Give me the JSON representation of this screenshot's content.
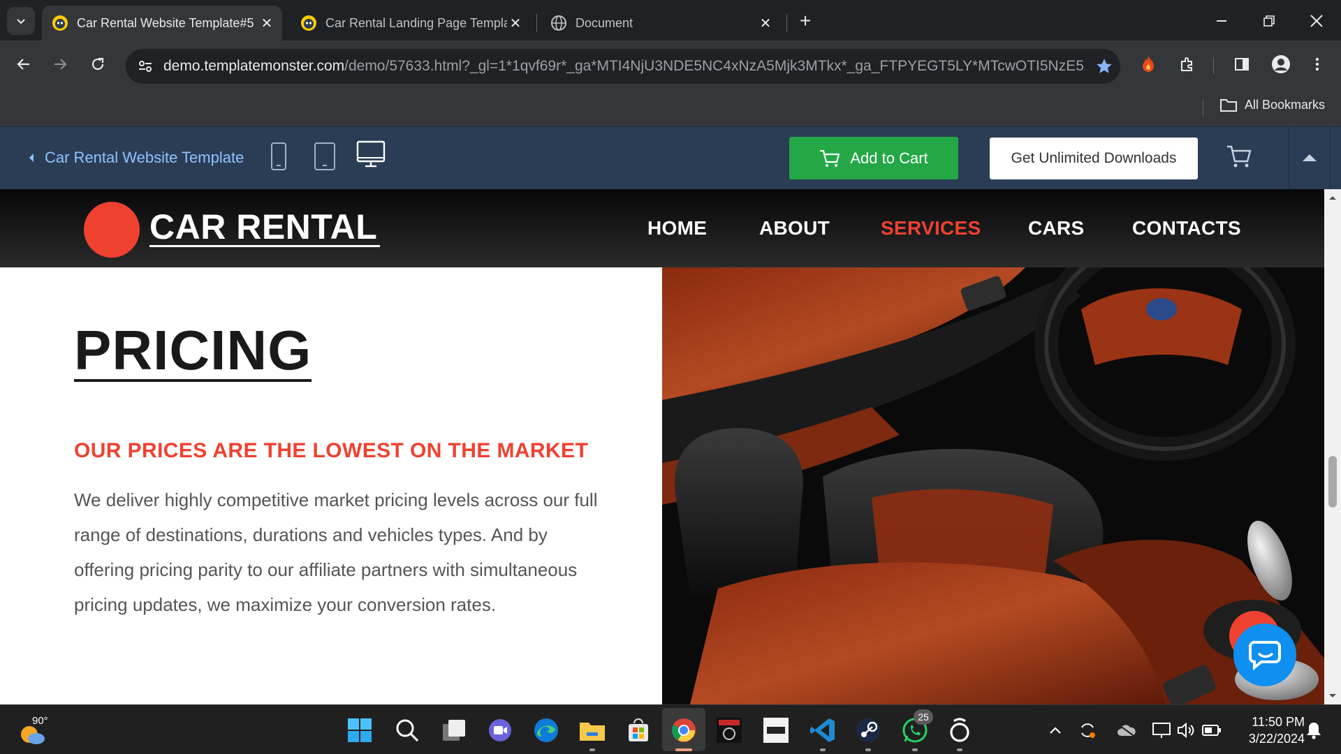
{
  "browser": {
    "tabs": [
      {
        "title": "Car Rental Website Template#5",
        "active": true
      },
      {
        "title": "Car Rental Landing Page Templa",
        "active": false
      },
      {
        "title": "Document",
        "active": false
      }
    ],
    "url_host": "demo.templatemonster.com",
    "url_rest": "/demo/57633.html?_gl=1*1qvf69r*_ga*MTI4NjU3NDE5NC4xNzA5Mjk3MTkx*_ga_FTPYEGT5LY*MTcwOTI5NzE5...",
    "bookmarks_label": "All Bookmarks"
  },
  "tm_bar": {
    "back_label": "Car Rental Website Template",
    "add_to_cart": "Add to Cart",
    "unlimited": "Get Unlimited Downloads"
  },
  "site": {
    "logo": "CAR RENTAL",
    "nav": [
      "HOME",
      "ABOUT",
      "SERVICES",
      "CARS",
      "CONTACTS"
    ],
    "active_nav": "SERVICES",
    "pricing_title": "PRICING",
    "pricing_subtitle": "OUR PRICES ARE THE LOWEST ON THE MARKET",
    "pricing_body": "We deliver highly competitive market pricing levels across our full range of destinations, durations and vehicles types. And by offering pricing parity to our affiliate partners with simultaneous pricing updates, we maximize your conversion rates."
  },
  "taskbar": {
    "weather": "90°",
    "whatsapp_badge": "25",
    "time": "11:50 PM",
    "date": "3/22/2024"
  },
  "colors": {
    "accent_red": "#ef4130",
    "cart_green": "#23a845",
    "tm_bar": "#2b3d55"
  }
}
